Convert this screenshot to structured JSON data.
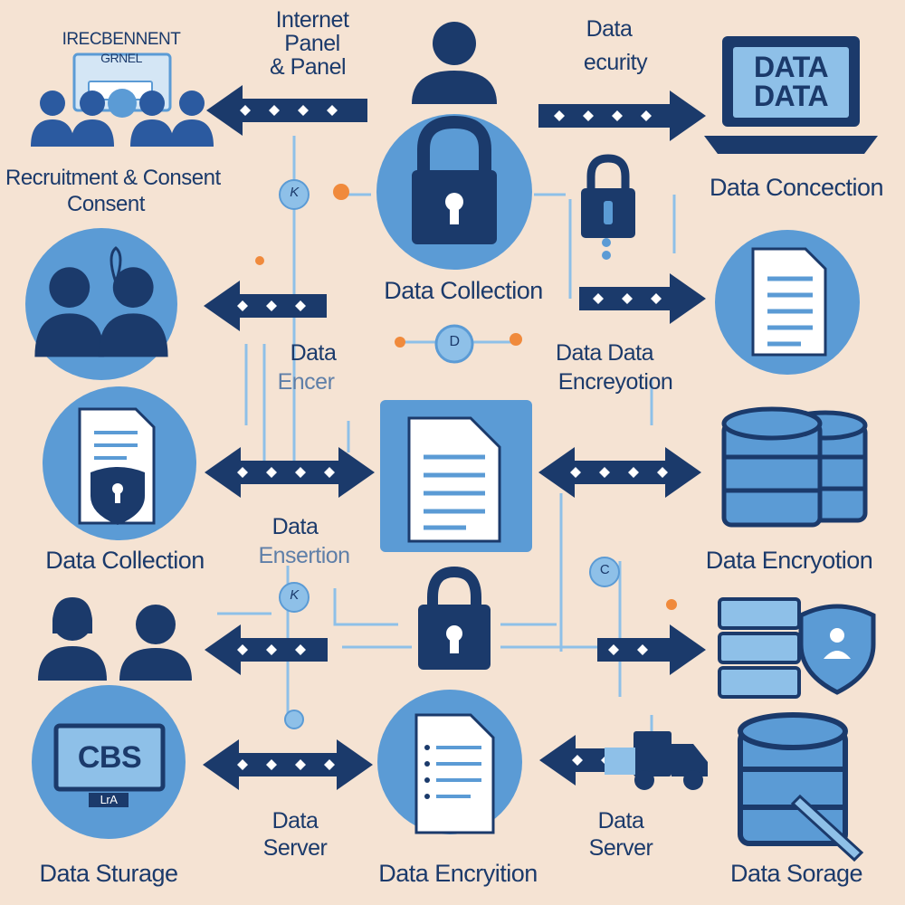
{
  "colors": {
    "background": "#f5e3d3",
    "navy": "#1b3a6b",
    "circle_blue": "#5b9bd5",
    "light_blue": "#8ec0e8",
    "orange_dot": "#f08a3c"
  },
  "labels": {
    "recruitment_panel_top": "IRECBENNENT",
    "recruitment_panel_bottom": "GRNEL",
    "internet_panel_1": "Internet",
    "internet_panel_2": "Panel",
    "internet_panel_3": "& Panel",
    "data_security_1": "Data",
    "data_security_2": "ecurity",
    "laptop_text_1": "DATA",
    "laptop_text_2": "DATA",
    "recruitment_consent_1": "Recruitment & Consent",
    "recruitment_consent_2": "Consent",
    "data_concection": "Data Concection",
    "data_collection_center": "Data Collection",
    "data_encer_1": "Data",
    "data_encer_2": "Encer",
    "data_data_encryption_1": "Data Data",
    "data_data_encryption_2": "Encreyotion",
    "data_collection_left": "Data Collection",
    "data_encryption_right": "Data Encryotion",
    "data_ensertion_1": "Data",
    "data_ensertion_2": "Ensertion",
    "monitor_text": "CBS",
    "monitor_stand_text": "LrA",
    "data_server_left_1": "Data",
    "data_server_left_2": "Server",
    "data_server_right_1": "Data",
    "data_server_right_2": "Server",
    "data_sturage": "Data Sturage",
    "data_encryition_bottom": "Data Encryition",
    "data_sorage": "Data Sorage",
    "node_letter_k1": "K",
    "node_letter_k2": "K",
    "node_letter_c": "C",
    "node_letter_d": "D"
  }
}
